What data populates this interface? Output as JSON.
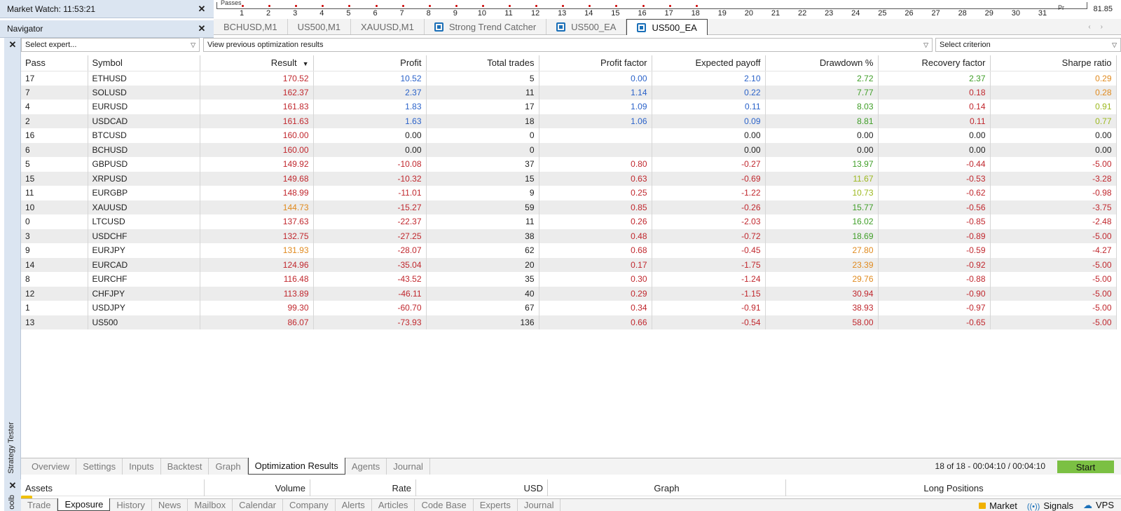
{
  "market_watch": {
    "title": "Market Watch: 11:53:21"
  },
  "navigator": {
    "title": "Navigator"
  },
  "top_strip": {
    "label_left": "Passes",
    "label_right": "Pr",
    "value": "81.85",
    "ticks": [
      "1",
      "2",
      "3",
      "4",
      "5",
      "6",
      "7",
      "8",
      "9",
      "10",
      "11",
      "12",
      "13",
      "14",
      "15",
      "16",
      "17",
      "18",
      "19",
      "20",
      "21",
      "22",
      "23",
      "24",
      "25",
      "26",
      "27",
      "28",
      "29",
      "30",
      "31"
    ]
  },
  "chart_tabs": [
    {
      "label": "BCHUSD,M1",
      "icon": false,
      "active": false
    },
    {
      "label": "US500,M1",
      "icon": false,
      "active": false
    },
    {
      "label": "XAUUSD,M1",
      "icon": false,
      "active": false
    },
    {
      "label": "Strong Trend Catcher",
      "icon": true,
      "active": false
    },
    {
      "label": "US500_EA",
      "icon": true,
      "active": false
    },
    {
      "label": "US500_EA",
      "icon": true,
      "active": true
    }
  ],
  "tab_arrows": {
    "left": "‹",
    "right": "›"
  },
  "strategy_tester": {
    "side_label": "Strategy Tester",
    "expert_select": "Select expert...",
    "results_select": "View previous optimization results",
    "criterion_select": "Select criterion",
    "columns": [
      "Pass",
      "Symbol",
      "Result",
      "Profit",
      "Total trades",
      "Profit factor",
      "Expected payoff",
      "Drawdown %",
      "Recovery factor",
      "Sharpe ratio"
    ],
    "sort_indicator": "▼",
    "colors": {
      "red": "#c0272d",
      "blue": "#2a62c9",
      "green": "#3f9e27",
      "orange": "#e08a1e",
      "black": "#1e1e1e",
      "yellowgreen": "#9cb81e"
    },
    "rows": [
      {
        "pass": "17",
        "symbol": "ETHUSD",
        "result": "170.52",
        "profit": "10.52",
        "trades": "5",
        "pf": "0.00",
        "ep": "2.10",
        "dd": "2.72",
        "rf": "2.37",
        "sr": "0.29",
        "c": [
          "red",
          "blue",
          "black",
          "blue",
          "blue",
          "green",
          "green",
          "orange"
        ]
      },
      {
        "pass": "7",
        "symbol": "SOLUSD",
        "result": "162.37",
        "profit": "2.37",
        "trades": "11",
        "pf": "1.14",
        "ep": "0.22",
        "dd": "7.77",
        "rf": "0.18",
        "sr": "0.28",
        "c": [
          "red",
          "blue",
          "black",
          "blue",
          "blue",
          "green",
          "red",
          "orange"
        ]
      },
      {
        "pass": "4",
        "symbol": "EURUSD",
        "result": "161.83",
        "profit": "1.83",
        "trades": "17",
        "pf": "1.09",
        "ep": "0.11",
        "dd": "8.03",
        "rf": "0.14",
        "sr": "0.91",
        "c": [
          "red",
          "blue",
          "black",
          "blue",
          "blue",
          "green",
          "red",
          "yellowgreen"
        ]
      },
      {
        "pass": "2",
        "symbol": "USDCAD",
        "result": "161.63",
        "profit": "1.63",
        "trades": "18",
        "pf": "1.06",
        "ep": "0.09",
        "dd": "8.81",
        "rf": "0.11",
        "sr": "0.77",
        "c": [
          "red",
          "blue",
          "black",
          "blue",
          "blue",
          "green",
          "red",
          "yellowgreen"
        ]
      },
      {
        "pass": "16",
        "symbol": "BTCUSD",
        "result": "160.00",
        "profit": "0.00",
        "trades": "0",
        "pf": "",
        "ep": "0.00",
        "dd": "0.00",
        "rf": "0.00",
        "sr": "0.00",
        "c": [
          "red",
          "black",
          "black",
          "black",
          "black",
          "black",
          "black",
          "black"
        ]
      },
      {
        "pass": "6",
        "symbol": "BCHUSD",
        "result": "160.00",
        "profit": "0.00",
        "trades": "0",
        "pf": "",
        "ep": "0.00",
        "dd": "0.00",
        "rf": "0.00",
        "sr": "0.00",
        "c": [
          "red",
          "black",
          "black",
          "black",
          "black",
          "black",
          "black",
          "black"
        ]
      },
      {
        "pass": "5",
        "symbol": "GBPUSD",
        "result": "149.92",
        "profit": "-10.08",
        "trades": "37",
        "pf": "0.80",
        "ep": "-0.27",
        "dd": "13.97",
        "rf": "-0.44",
        "sr": "-5.00",
        "c": [
          "red",
          "red",
          "black",
          "red",
          "red",
          "green",
          "red",
          "red"
        ]
      },
      {
        "pass": "15",
        "symbol": "XRPUSD",
        "result": "149.68",
        "profit": "-10.32",
        "trades": "15",
        "pf": "0.63",
        "ep": "-0.69",
        "dd": "11.67",
        "rf": "-0.53",
        "sr": "-3.28",
        "c": [
          "red",
          "red",
          "black",
          "red",
          "red",
          "yellowgreen",
          "red",
          "red"
        ]
      },
      {
        "pass": "11",
        "symbol": "EURGBP",
        "result": "148.99",
        "profit": "-11.01",
        "trades": "9",
        "pf": "0.25",
        "ep": "-1.22",
        "dd": "10.73",
        "rf": "-0.62",
        "sr": "-0.98",
        "c": [
          "red",
          "red",
          "black",
          "red",
          "red",
          "yellowgreen",
          "red",
          "red"
        ]
      },
      {
        "pass": "10",
        "symbol": "XAUUSD",
        "result": "144.73",
        "profit": "-15.27",
        "trades": "59",
        "pf": "0.85",
        "ep": "-0.26",
        "dd": "15.77",
        "rf": "-0.56",
        "sr": "-3.75",
        "c": [
          "orange",
          "red",
          "black",
          "red",
          "red",
          "green",
          "red",
          "red"
        ]
      },
      {
        "pass": "0",
        "symbol": "LTCUSD",
        "result": "137.63",
        "profit": "-22.37",
        "trades": "11",
        "pf": "0.26",
        "ep": "-2.03",
        "dd": "16.02",
        "rf": "-0.85",
        "sr": "-2.48",
        "c": [
          "red",
          "red",
          "black",
          "red",
          "red",
          "green",
          "red",
          "red"
        ]
      },
      {
        "pass": "3",
        "symbol": "USDCHF",
        "result": "132.75",
        "profit": "-27.25",
        "trades": "38",
        "pf": "0.48",
        "ep": "-0.72",
        "dd": "18.69",
        "rf": "-0.89",
        "sr": "-5.00",
        "c": [
          "red",
          "red",
          "black",
          "red",
          "red",
          "green",
          "red",
          "red"
        ]
      },
      {
        "pass": "9",
        "symbol": "EURJPY",
        "result": "131.93",
        "profit": "-28.07",
        "trades": "62",
        "pf": "0.68",
        "ep": "-0.45",
        "dd": "27.80",
        "rf": "-0.59",
        "sr": "-4.27",
        "c": [
          "orange",
          "red",
          "black",
          "red",
          "red",
          "orange",
          "red",
          "red"
        ]
      },
      {
        "pass": "14",
        "symbol": "EURCAD",
        "result": "124.96",
        "profit": "-35.04",
        "trades": "20",
        "pf": "0.17",
        "ep": "-1.75",
        "dd": "23.39",
        "rf": "-0.92",
        "sr": "-5.00",
        "c": [
          "red",
          "red",
          "black",
          "red",
          "red",
          "orange",
          "red",
          "red"
        ]
      },
      {
        "pass": "8",
        "symbol": "EURCHF",
        "result": "116.48",
        "profit": "-43.52",
        "trades": "35",
        "pf": "0.30",
        "ep": "-1.24",
        "dd": "29.76",
        "rf": "-0.88",
        "sr": "-5.00",
        "c": [
          "red",
          "red",
          "black",
          "red",
          "red",
          "orange",
          "red",
          "red"
        ]
      },
      {
        "pass": "12",
        "symbol": "CHFJPY",
        "result": "113.89",
        "profit": "-46.11",
        "trades": "40",
        "pf": "0.29",
        "ep": "-1.15",
        "dd": "30.94",
        "rf": "-0.90",
        "sr": "-5.00",
        "c": [
          "red",
          "red",
          "black",
          "red",
          "red",
          "red",
          "red",
          "red"
        ]
      },
      {
        "pass": "1",
        "symbol": "USDJPY",
        "result": "99.30",
        "profit": "-60.70",
        "trades": "67",
        "pf": "0.34",
        "ep": "-0.91",
        "dd": "38.93",
        "rf": "-0.97",
        "sr": "-5.00",
        "c": [
          "red",
          "red",
          "black",
          "red",
          "red",
          "red",
          "red",
          "red"
        ]
      },
      {
        "pass": "13",
        "symbol": "US500",
        "result": "86.07",
        "profit": "-73.93",
        "trades": "136",
        "pf": "0.66",
        "ep": "-0.54",
        "dd": "58.00",
        "rf": "-0.65",
        "sr": "-5.00",
        "c": [
          "red",
          "red",
          "black",
          "red",
          "red",
          "red",
          "red",
          "red"
        ]
      }
    ],
    "tabs": [
      {
        "label": "Overview",
        "active": false
      },
      {
        "label": "Settings",
        "active": false
      },
      {
        "label": "Inputs",
        "active": false
      },
      {
        "label": "Backtest",
        "active": false
      },
      {
        "label": "Graph",
        "active": false
      },
      {
        "label": "Optimization Results",
        "active": true
      },
      {
        "label": "Agents",
        "active": false
      },
      {
        "label": "Journal",
        "active": false
      }
    ],
    "status": "18 of 18  -  00:04:10 / 00:04:10",
    "start_label": "Start"
  },
  "toolbox": {
    "side_label": "oolb",
    "columns": [
      "Assets",
      "Volume",
      "Rate",
      "USD",
      "Graph",
      "Long Positions"
    ],
    "tabs": [
      {
        "label": "Trade",
        "active": false
      },
      {
        "label": "Exposure",
        "active": true
      },
      {
        "label": "History",
        "active": false
      },
      {
        "label": "News",
        "active": false
      },
      {
        "label": "Mailbox",
        "active": false
      },
      {
        "label": "Calendar",
        "active": false
      },
      {
        "label": "Company",
        "active": false
      },
      {
        "label": "Alerts",
        "active": false
      },
      {
        "label": "Articles",
        "active": false
      },
      {
        "label": "Code Base",
        "active": false
      },
      {
        "label": "Experts",
        "active": false
      },
      {
        "label": "Journal",
        "active": false
      }
    ],
    "right": {
      "market": "Market",
      "signals": "Signals",
      "vps": "VPS"
    }
  }
}
